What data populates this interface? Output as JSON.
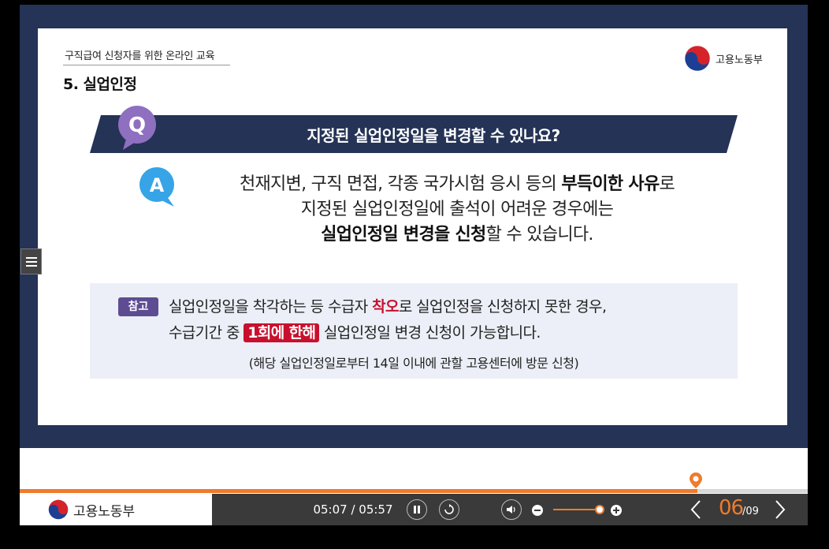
{
  "slide": {
    "course_title": "구직급여 신청자를 위한 온라인 교육",
    "section_title": "5. 실업인정",
    "logo_text": "고용노동부",
    "question": "지정된 실업인정일을 변경할 수 있나요?",
    "answer": {
      "l1a": "천재지변, 구직 면접, 각종 국가시험 응시 등의 ",
      "l1b": "부득이한 사유",
      "l1c": "로",
      "l2": "지정된 실업인정일에 출석이 어려운 경우에는",
      "l3a": "실업인정일 변경을 신청",
      "l3b": "할 수 있습니다."
    },
    "note": {
      "tag": "참고",
      "l1a": "실업인정일을 착각하는 등 수급자 ",
      "l1b": "착오",
      "l1c": "로 실업인정을 신청하지 못한 경우,",
      "l2a": "수급기간 중 ",
      "l2b": "1회에 한해",
      "l2c": " 실업인정일 변경 신청이 가능합니다.",
      "l3": "(해당 실업인정일로부터 14일 이내에 관할 고용센터에 방문 신청)"
    }
  },
  "player": {
    "logo_text": "고용노동부",
    "time": "05:07 / 05:57",
    "progress": 0.86,
    "volume": 0.85,
    "page_current": "06",
    "page_total": "/09",
    "icons": [
      "menu-icon",
      "pause-icon",
      "replay-icon",
      "volume-icon",
      "volume-down-icon",
      "volume-up-icon",
      "prev-icon",
      "next-icon",
      "location-marker-icon"
    ]
  },
  "colors": {
    "frame": "#243356",
    "accent": "#ef7b2c",
    "highlight": "#c8102e",
    "tag": "#5e4c93"
  }
}
